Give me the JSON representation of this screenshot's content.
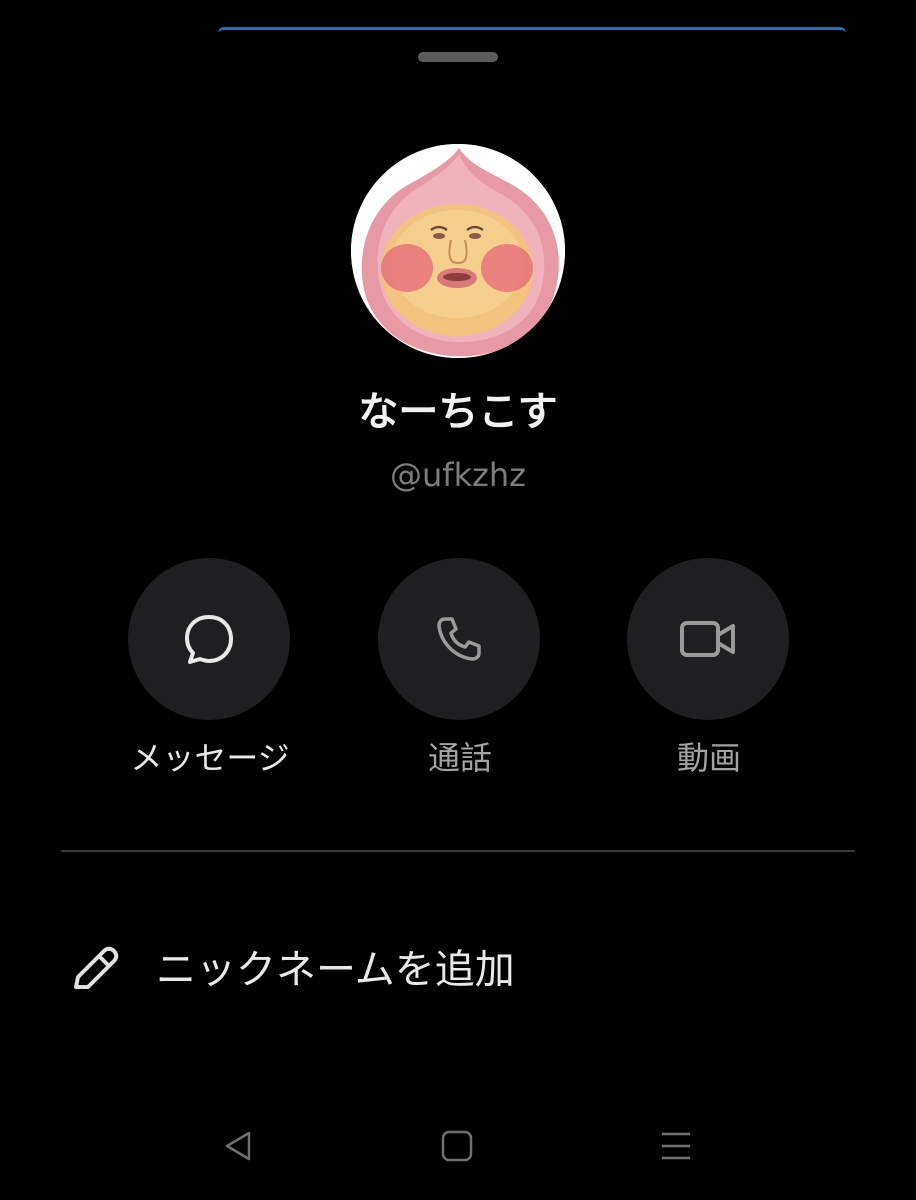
{
  "profile": {
    "display_name": "なーちこす",
    "handle": "@ufkzhz",
    "avatar_icon": "avatar-illustration"
  },
  "actions": [
    {
      "label": "メッセージ",
      "icon": "message-bubble-icon"
    },
    {
      "label": "通話",
      "icon": "phone-icon"
    },
    {
      "label": "動画",
      "icon": "video-camera-icon"
    }
  ],
  "nickname": {
    "label": "ニックネームを追加",
    "icon": "pencil-icon"
  },
  "navbar": {
    "back_icon": "back-triangle-icon",
    "home_icon": "home-square-icon",
    "menu_icon": "menu-lines-icon"
  },
  "colors": {
    "background": "#000000",
    "button_fill": "#1f1f21",
    "accent": "#2f6fb0",
    "divider": "#3b3b3d"
  }
}
